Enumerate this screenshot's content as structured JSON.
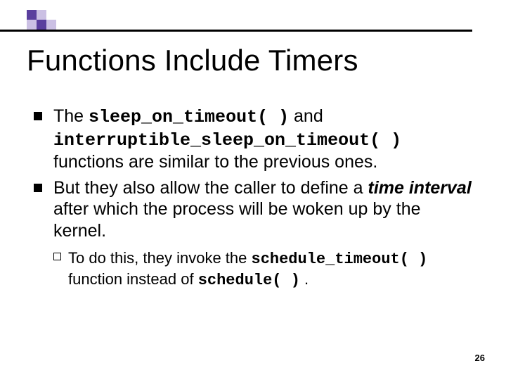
{
  "title": "Functions Include Timers",
  "bullets": [
    {
      "pre": "The ",
      "code1": "sleep_on_timeout( )",
      "mid1": " and ",
      "code2": "interruptible_sleep_on_timeout( )",
      "post": " functions are similar to the previous ones."
    },
    {
      "pre": "But they also allow the caller to define a ",
      "em": "time interval",
      "post": " after which the process will be woken up by the kernel."
    }
  ],
  "sub": {
    "pre": "To do this, they invoke the ",
    "code1": "schedule_timeout( )",
    "mid": " function instead of ",
    "code2": "schedule( )",
    "post": " ."
  },
  "page_number": "26"
}
